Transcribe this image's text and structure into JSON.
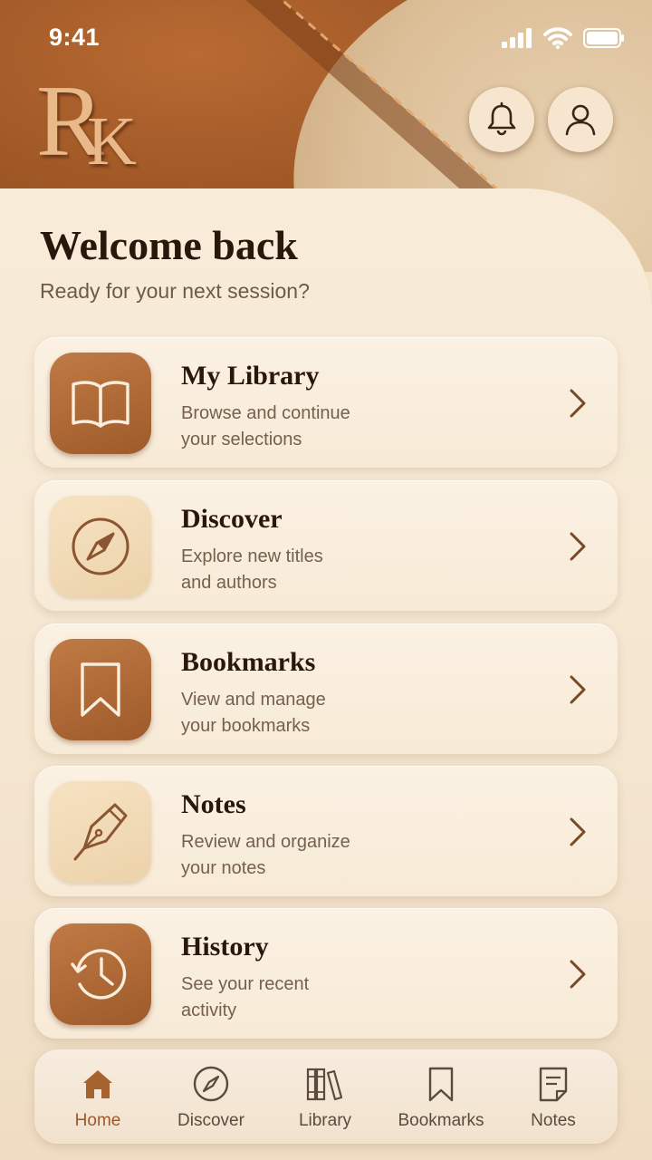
{
  "status_bar": {
    "time": "9:41"
  },
  "brand": {
    "logo_text": "RK"
  },
  "header": {
    "notifications_icon": "bell-icon",
    "profile_icon": "user-icon"
  },
  "main": {
    "title": "Welcome back",
    "subtitle": "Ready for your next session?",
    "cards": [
      {
        "title": "My Library",
        "desc_line1": "Browse and continue",
        "desc_line2": "your selections",
        "icon": "open-book-icon"
      },
      {
        "title": "Discover",
        "desc_line1": "Explore new titles",
        "desc_line2": "and authors",
        "icon": "compass-icon"
      },
      {
        "title": "Bookmarks",
        "desc_line1": "View and manage",
        "desc_line2": "your bookmarks",
        "icon": "bookmark-icon"
      },
      {
        "title": "Notes",
        "desc_line1": "Review and organize",
        "desc_line2": "your notes",
        "icon": "pen-nib-icon"
      },
      {
        "title": "History",
        "desc_line1": "See your recent",
        "desc_line2": "activity",
        "icon": "history-clock-icon"
      }
    ]
  },
  "tabbar": {
    "active": "Home",
    "tabs": [
      {
        "label": "Home",
        "icon": "home-icon"
      },
      {
        "label": "Discover",
        "icon": "compass-icon"
      },
      {
        "label": "Library",
        "icon": "books-icon"
      },
      {
        "label": "Bookmarks",
        "icon": "bookmark-icon"
      },
      {
        "label": "Notes",
        "icon": "note-icon"
      }
    ]
  },
  "colors": {
    "leather": "#9a5423",
    "accent": "#9a5a2c",
    "background": "#f3e3cb",
    "text_dark": "#2a170c",
    "text_muted": "#75604f"
  }
}
